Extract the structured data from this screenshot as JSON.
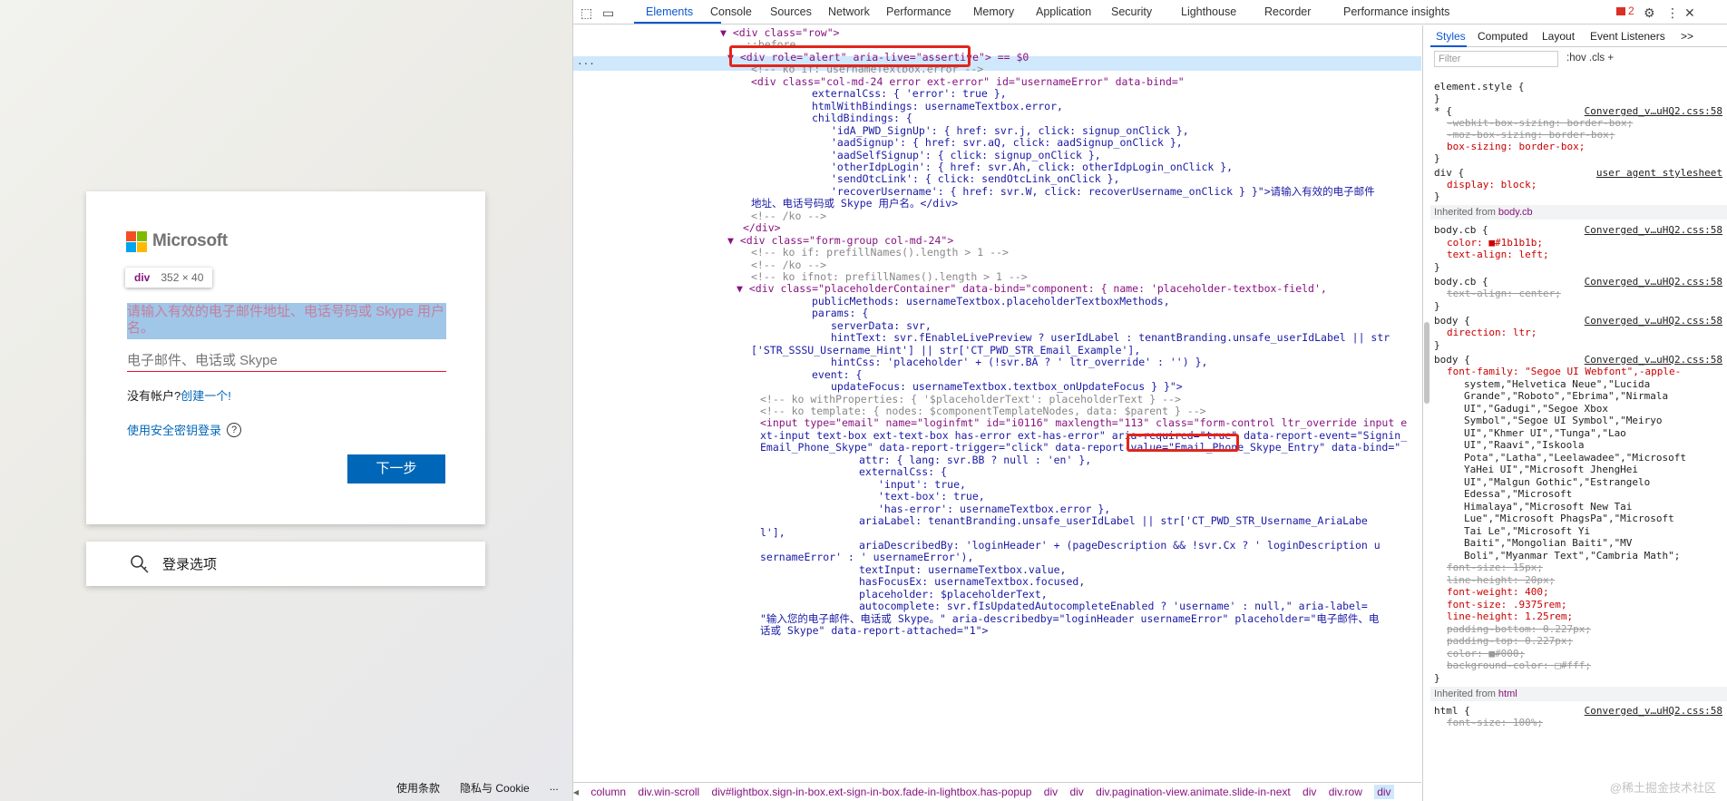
{
  "login": {
    "brand": "Microsoft",
    "tooltip_tag": "div",
    "tooltip_size": "352 × 40",
    "error_text": "请输入有效的电子邮件地址、电话号码或 Skype 用户名。",
    "input_placeholder": "电子邮件、电话或 Skype",
    "no_account": "没有帐户?",
    "create_link": "创建一个!",
    "security_key": "使用安全密钥登录",
    "next_button": "下一步",
    "signin_options": "登录选项",
    "footer": [
      "使用条款",
      "隐私与 Cookie",
      "..."
    ]
  },
  "devtools": {
    "tabs": [
      "Elements",
      "Console",
      "Sources",
      "Network",
      "Performance",
      "Memory",
      "Application",
      "Security",
      "Lighthouse",
      "Recorder",
      "Performance insights"
    ],
    "issues_count": "2",
    "code_lines": [
      "<div class=\"row\">",
      "::before",
      "<div role=\"alert\" aria-live=\"assertive\"> == $0",
      "<!-- ko if: usernameTextbox.error -->",
      "<div class=\"col-md-24 error ext-error\" id=\"usernameError\" data-bind=\"",
      "externalCss: { 'error': true },",
      "htmlWithBindings: usernameTextbox.error,",
      "childBindings: {",
      "'idA_PWD_SignUp': { href: svr.j, click: signup_onClick },",
      "'aadSignup': { href: svr.aQ, click: aadSignup_onClick },",
      "'aadSelfSignup': { click: signup_onClick },",
      "'otherIdpLogin': { href: svr.Ah, click: otherIdpLogin_onClick },",
      "'sendOtcLink': { click: sendOtcLink_onClick },",
      "'recoverUsername': { href: svr.W, click: recoverUsername_onClick } }\">请输入有效的电子邮件",
      "地址、电话号码或 Skype 用户名。</div>",
      "<!-- /ko -->",
      "</div>",
      "<div class=\"form-group col-md-24\">",
      "<!-- ko if: prefillNames().length > 1 -->",
      "<!-- /ko -->",
      "<!-- ko ifnot: prefillNames().length > 1 -->",
      "<div class=\"placeholderContainer\" data-bind=\"component: { name: 'placeholder-textbox-field',",
      "publicMethods: usernameTextbox.placeholderTextboxMethods,",
      "params: {",
      "serverData: svr,",
      "hintText: svr.fEnableLivePreview ? userIdLabel : tenantBranding.unsafe_userIdLabel || str",
      "['STR_SSSU_Username_Hint'] || str['CT_PWD_STR_Email_Example'],",
      "hintCss: 'placeholder' + (!svr.BA ? ' ltr_override' : '') },",
      "event: {",
      "updateFocus: usernameTextbox.textbox_onUpdateFocus } }\">",
      "<!-- ko withProperties: { '$placeholderText': placeholderText } -->",
      "<!-- ko template: { nodes: $componentTemplateNodes, data: $parent } -->",
      "<input type=\"email\" name=\"loginfmt\" id=\"i0116\" maxlength=\"113\" class=\"form-control ltr_override input e",
      "xt-input text-box ext-text-box has-error ext-has-error\" aria-required=\"true\" data-report-event=\"Signin_",
      "Email_Phone_Skype\" data-report-trigger=\"click\" data-report-value=\"Email_Phone_Skype_Entry\" data-bind=\"",
      "attr: { lang: svr.BB ? null : 'en' },",
      "externalCss: {",
      "'input': true,",
      "'text-box': true,",
      "'has-error': usernameTextbox.error },",
      "ariaLabel: tenantBranding.unsafe_userIdLabel || str['CT_PWD_STR_Username_AriaLabe",
      "l'],",
      "ariaDescribedBy: 'loginHeader' + (pageDescription && !svr.Cx ? ' loginDescription u",
      "sernameError' : ' usernameError'),",
      "textInput: usernameTextbox.value,",
      "hasFocusEx: usernameTextbox.focused,",
      "placeholder: $placeholderText,",
      "autocomplete: svr.fIsUpdatedAutocompleteEnabled ? 'username' : null,\" aria-label=",
      "\"输入您的电子邮件、电话或 Skype。\" aria-describedby=\"loginHeader usernameError\" placeholder=\"电子邮件、电",
      "话或 Skype\" data-report-attached=\"1\">"
    ],
    "breadcrumbs": [
      "column",
      "div.win-scroll",
      "div#lightbox.sign-in-box.ext-sign-in-box.fade-in-lightbox.has-popup",
      "div",
      "div",
      "div.pagination-view.animate.slide-in-next",
      "div",
      "div.row",
      "div"
    ],
    "styles": {
      "tabs": [
        "Styles",
        "Computed",
        "Layout",
        "Event Listeners",
        ">>"
      ],
      "filter_placeholder": "Filter",
      "filter_tools": ":hov  .cls  +",
      "source": "Converged_v…uHQ2.css:58",
      "ua_source": "user agent stylesheet",
      "inherited_body": "Inherited from",
      "inherited_body_sel": "body.cb",
      "inherited_html_sel": "html",
      "lines": [
        "element.style {",
        "}",
        "* {",
        "-webkit-box-sizing: border-box;",
        "-moz-box-sizing: border-box;",
        "box-sizing: border-box;",
        "}",
        "div {",
        "display: block;",
        "}"
      ],
      "body_lines": [
        "body.cb {",
        "color: ■#1b1b1b;",
        "text-align: left;",
        "}",
        "body.cb {",
        "text-align: center;",
        "}",
        "body {",
        "direction: ltr;",
        "}",
        "body {",
        "font-family: \"Segoe UI Webfont\",-apple-",
        "system,\"Helvetica Neue\",\"Lucida",
        "Grande\",\"Roboto\",\"Ebrima\",\"Nirmala",
        "UI\",\"Gadugi\",\"Segoe Xbox",
        "Symbol\",\"Segoe UI Symbol\",\"Meiryo",
        "UI\",\"Khmer UI\",\"Tunga\",\"Lao",
        "UI\",\"Raavi\",\"Iskoola",
        "Pota\",\"Latha\",\"Leelawadee\",\"Microsoft",
        "YaHei UI\",\"Microsoft JhengHei",
        "UI\",\"Malgun Gothic\",\"Estrangelo",
        "Edessa\",\"Microsoft",
        "Himalaya\",\"Microsoft New Tai",
        "Lue\",\"Microsoft PhagsPa\",\"Microsoft",
        "Tai Le\",\"Microsoft Yi",
        "Baiti\",\"Mongolian Baiti\",\"MV",
        "Boli\",\"Myanmar Text\",\"Cambria Math\";",
        "font-size: 15px;",
        "line-height: 20px;",
        "font-weight: 400;",
        "font-size: .9375rem;",
        "line-height: 1.25rem;",
        "padding-bottom: 0.227px;",
        "padding-top: 0.227px;",
        "color: ■#000;",
        "background-color: □#fff;",
        "}"
      ],
      "html_lines": [
        "html {",
        "font-size: 100%;"
      ]
    },
    "watermark": "@稀土掘金技术社区"
  }
}
